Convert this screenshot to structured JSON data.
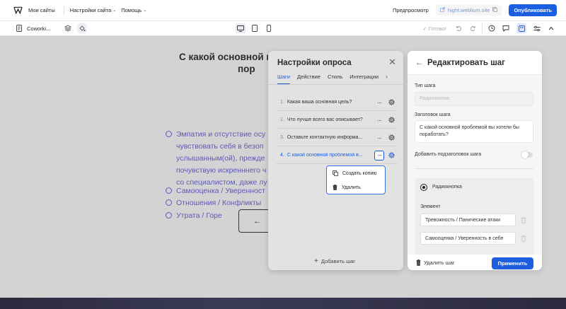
{
  "topbar": {
    "brand": "Мои сайты",
    "menu_settings": "Настройки сайта",
    "menu_help": "Помощь",
    "preview": "Предпросмотр",
    "site_url": "hight.weblium.site",
    "publish": "Опубликовать"
  },
  "toolbar": {
    "page_name": "Coworki...",
    "status": "✓ Готово!"
  },
  "question": {
    "title_line1": "С какой основной п",
    "title_line2": "пор",
    "options": [
      {
        "lines": [
          "Эмпатия и отсутствие осу",
          "чувствовать себя в безоп",
          "услышанным(ой), прежде",
          "почувствую искренннего ч",
          "со специалистом, даже лу"
        ]
      },
      {
        "lines": [
          "Самооценка / Уверенност"
        ]
      },
      {
        "lines": [
          "Отношения / Конфликты"
        ]
      },
      {
        "lines": [
          "Утрата / Горе"
        ]
      }
    ],
    "back_arrow": "←"
  },
  "survey_panel": {
    "title": "Настройки опроса",
    "tabs": [
      "Шаги",
      "Действие",
      "Стиль",
      "Интеграции",
      "I"
    ],
    "steps": [
      {
        "num": "1.",
        "label": "Какая ваша основная цель?"
      },
      {
        "num": "2.",
        "label": "Что лучше всего вас описывает?"
      },
      {
        "num": "3.",
        "label": "Оставьте контактную информа..."
      },
      {
        "num": "4.",
        "label": "С какой основной проблемой в..."
      }
    ],
    "context_menu": {
      "copy": "Создать копию",
      "delete": "Удалить"
    },
    "add_step": "Добавить шаг"
  },
  "edit_panel": {
    "title": "Редактировать шаг",
    "step_type_label": "Тип шага",
    "step_type_value": "Радиокнопка",
    "step_title_label": "Заголовок шага",
    "step_title_value": "С какой основной проблемой вы хотели бы поработать?",
    "subtitle_toggle_label": "Добавить подзаголовок шага",
    "radio_label": "Радиокнопка",
    "element_label": "Элемент",
    "elements": [
      "Тревожность / Панические атаки",
      "Самооценка / Уверенность в себе"
    ],
    "delete_step": "Удалить шаг",
    "apply": "Применить"
  },
  "colors": {
    "accent": "#1b5fe0",
    "option_text": "#5e59b5",
    "page_bg": "#d3d3d3"
  }
}
